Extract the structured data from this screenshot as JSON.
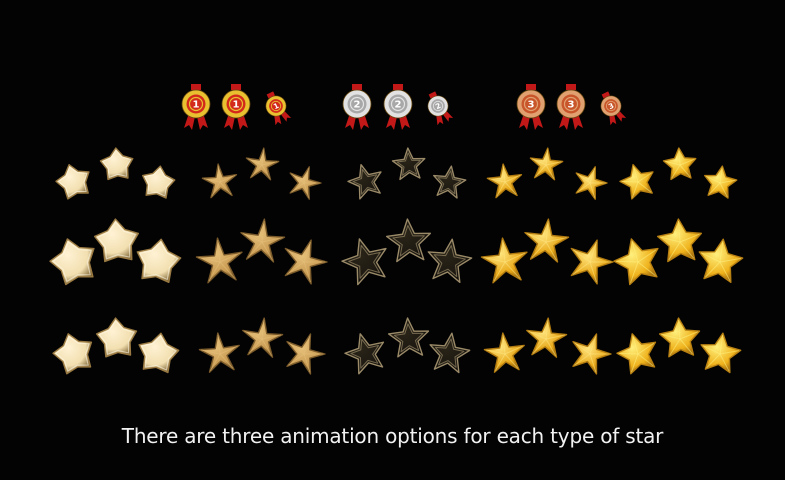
{
  "caption": "There are three animation options for each type of star",
  "medals": [
    {
      "name": "gold-medal-icon",
      "rank": "1",
      "ring": "#e8c030",
      "face": "#d42a1c",
      "ribbon": "#c21818"
    },
    {
      "name": "silver-medal-icon",
      "rank": "2",
      "ring": "#e2e2e2",
      "face": "#a8a8a8",
      "ribbon": "#c21818"
    },
    {
      "name": "bronze-medal-icon",
      "rank": "3",
      "ring": "#e0a070",
      "face": "#c8562a",
      "ribbon": "#c21818"
    }
  ],
  "star_types": [
    {
      "name": "cream-plump-star",
      "shape": "plump",
      "fill": "#f2dfb0",
      "fill_light": "#fff2d4",
      "edge": "#7a6030",
      "stroke": "#9a7a42"
    },
    {
      "name": "sand-starfish-star",
      "shape": "starfish",
      "fill": "#c89a52",
      "fill_light": "#e6c07a",
      "edge": "#6e4f22",
      "stroke": "#7a5a2a"
    },
    {
      "name": "dark-outline-star",
      "shape": "outline",
      "fill": "#1e1a12",
      "fill_light": "#2a2418",
      "edge": "#0a0806",
      "stroke": "#9a8a68"
    },
    {
      "name": "gold-slim-star",
      "shape": "slim",
      "fill": "#e8a818",
      "fill_light": "#ffe680",
      "edge": "#8a5a08",
      "stroke": "#b07a10"
    },
    {
      "name": "gold-plump-star",
      "shape": "goldplump",
      "fill": "#efb21c",
      "fill_light": "#fff07e",
      "edge": "#915c08",
      "stroke": "#b88012"
    }
  ],
  "animation_options": [
    "static",
    "glow",
    "bounce"
  ]
}
